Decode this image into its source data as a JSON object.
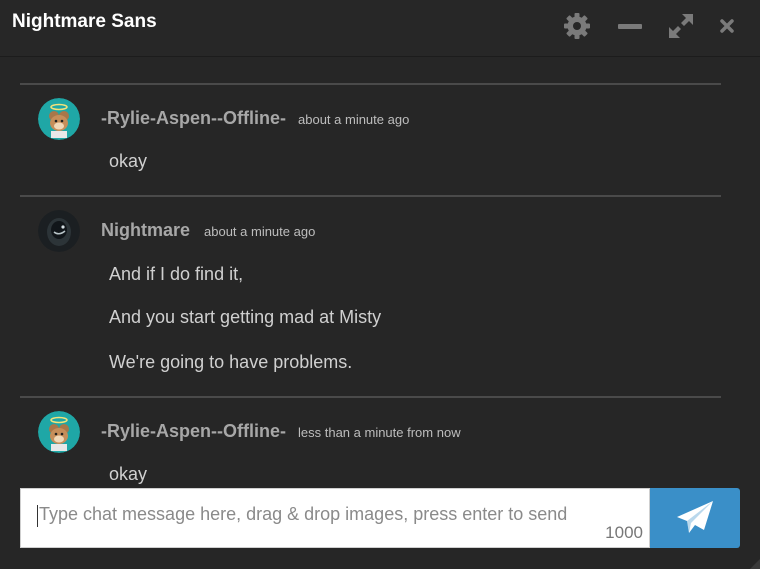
{
  "window": {
    "title": "Nightmare Sans"
  },
  "messages": [
    {
      "username": "-Rylie-Aspen--Offline-",
      "timestamp": "about a minute ago",
      "lines": [
        "okay"
      ]
    },
    {
      "username": "Nightmare",
      "timestamp": "about a minute ago",
      "lines": [
        "And if I do find it,",
        "And you start getting mad at Misty",
        "We're going to have problems."
      ]
    },
    {
      "username": "-Rylie-Aspen--Offline-",
      "timestamp": "less than a minute from now",
      "lines": [
        "okay"
      ]
    }
  ],
  "composer": {
    "placeholder": "Type chat message here, drag & drop images, press enter to send",
    "char_limit": "1000"
  },
  "colors": {
    "background": "#262626",
    "send_button": "#3a8fc8",
    "divider": "#4a4a4a"
  },
  "icons": {
    "settings": "gear-icon",
    "minimize": "minus-icon",
    "expand": "expand-icon",
    "close": "close-icon",
    "send": "paper-plane-icon"
  }
}
